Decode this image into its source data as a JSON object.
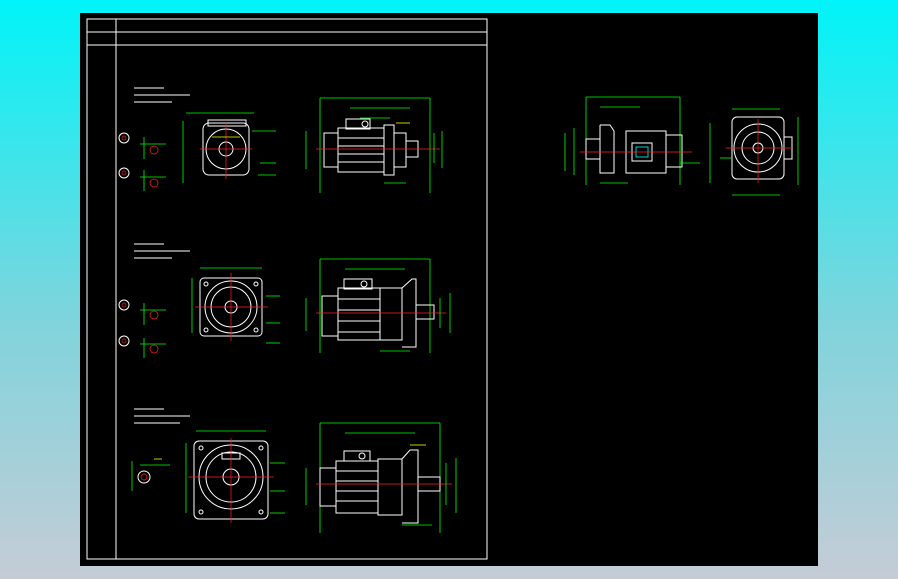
{
  "colors": {
    "background_top": "#00f4f8",
    "background_bottom": "#c5ccd6",
    "drawing_area": "#000000",
    "frame": "#ffffff",
    "dimension": "#00ff00",
    "centerline": "#ff2020",
    "accent": "#ffff00"
  },
  "drawing": {
    "views": [
      {
        "row": 1,
        "notes": [
          "",
          "",
          ""
        ],
        "parts": [
          "front-view",
          "side-view",
          "shaft-details"
        ]
      },
      {
        "row": 2,
        "notes": [
          "",
          "",
          ""
        ],
        "parts": [
          "front-view",
          "side-view",
          "shaft-details"
        ]
      },
      {
        "row": 3,
        "notes": [
          "",
          "",
          ""
        ],
        "parts": [
          "front-view",
          "side-view",
          "shaft-detail"
        ]
      },
      {
        "row": 0,
        "notes": [],
        "parts": [
          "side-view-right",
          "front-view-right"
        ]
      }
    ]
  }
}
